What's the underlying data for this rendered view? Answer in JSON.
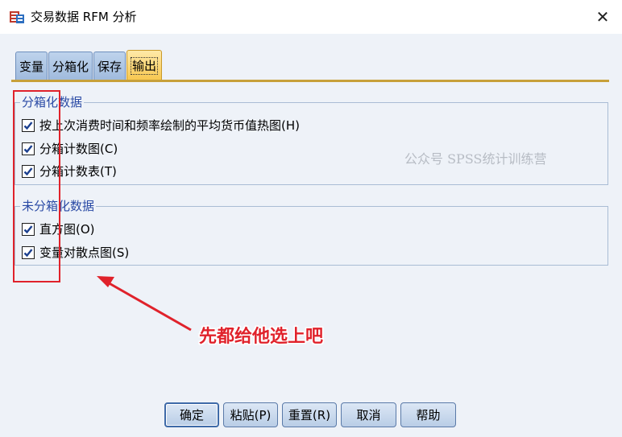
{
  "window": {
    "title": "交易数据 RFM 分析",
    "close_glyph": "✕"
  },
  "tabs": [
    {
      "label": "变量"
    },
    {
      "label": "分箱化"
    },
    {
      "label": "保存"
    },
    {
      "label": "输出"
    }
  ],
  "binned_group": {
    "legend": "分箱化数据",
    "options": [
      {
        "label": "按上次消费时间和频率绘制的平均货币值热图(H)",
        "checked": true
      },
      {
        "label": "分箱计数图(C)",
        "checked": true
      },
      {
        "label": "分箱计数表(T)",
        "checked": true
      }
    ]
  },
  "unbinned_group": {
    "legend": "未分箱化数据",
    "options": [
      {
        "label": "直方图(O)",
        "checked": true
      },
      {
        "label": "变量对散点图(S)",
        "checked": true
      }
    ]
  },
  "watermark": "公众号 SPSS统计训练营",
  "annotation": "先都给他选上吧",
  "buttons": [
    {
      "label": "确定"
    },
    {
      "label": "粘贴(P)"
    },
    {
      "label": "重置(R)"
    },
    {
      "label": "取消"
    },
    {
      "label": "帮助"
    }
  ],
  "colors": {
    "annotation_red": "#e0222b",
    "group_legend_blue": "#2a4aa5",
    "active_tab": "#f7c74e"
  }
}
